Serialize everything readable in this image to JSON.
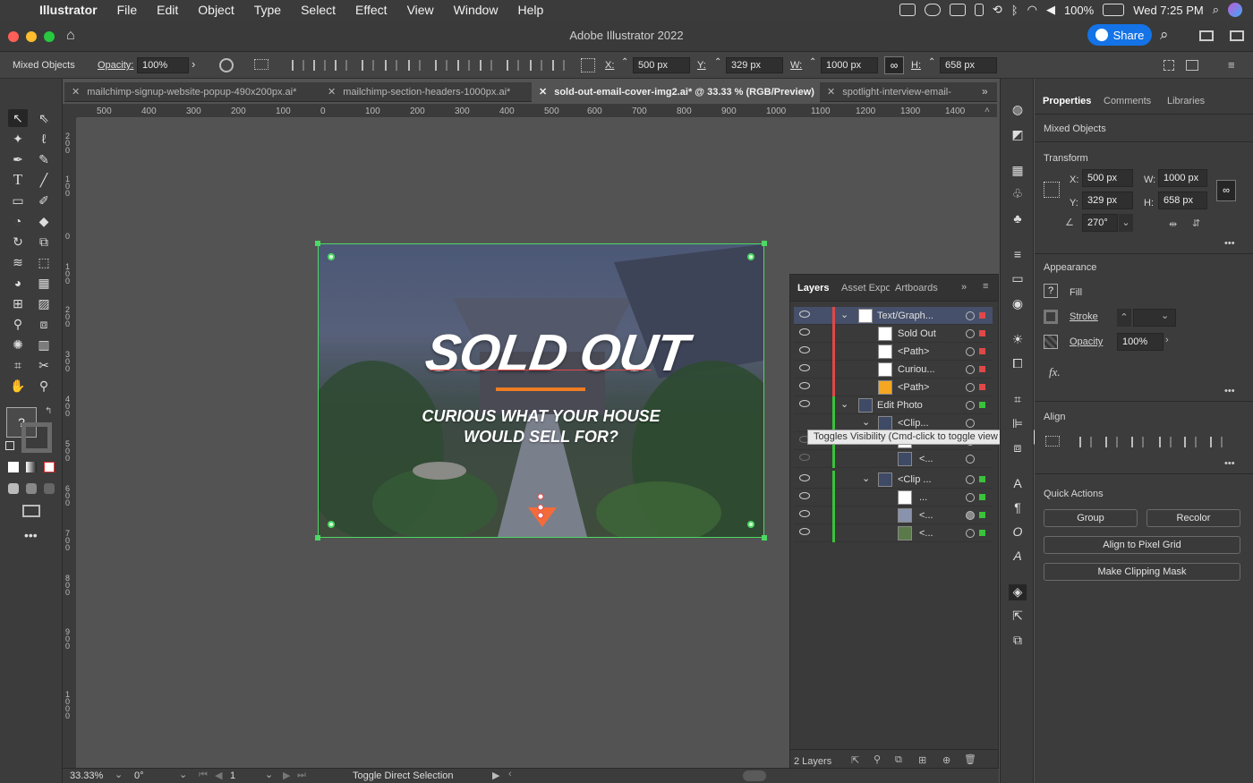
{
  "menubar": {
    "app": "Illustrator",
    "items": [
      "File",
      "Edit",
      "Object",
      "Type",
      "Select",
      "Effect",
      "View",
      "Window",
      "Help"
    ],
    "battery": "100%",
    "clock": "Wed 7:25 PM"
  },
  "appbar": {
    "title": "Adobe Illustrator 2022",
    "share_label": "Share"
  },
  "control": {
    "selection_label": "Mixed Objects",
    "opacity_label": "Opacity:",
    "opacity_value": "100%",
    "x_label": "X:",
    "x_value": "500 px",
    "y_label": "Y:",
    "y_value": "329 px",
    "w_label": "W:",
    "w_value": "1000 px",
    "h_label": "H:",
    "h_value": "658 px"
  },
  "tabs": [
    {
      "label": "mailchimp-signup-website-popup-490x200px.ai*"
    },
    {
      "label": "mailchimp-section-headers-1000px.ai*"
    },
    {
      "label": "sold-out-email-cover-img2.ai* @ 33.33 % (RGB/Preview)"
    },
    {
      "label": "spotlight-interview-email-"
    }
  ],
  "ruler": {
    "h": [
      "500",
      "400",
      "300",
      "200",
      "100",
      "0",
      "100",
      "200",
      "300",
      "400",
      "500",
      "600",
      "700",
      "800",
      "900",
      "1000",
      "1100",
      "1200",
      "1300",
      "1400"
    ],
    "v": [
      "200",
      "100",
      "0",
      "100",
      "200",
      "300",
      "400",
      "500",
      "600",
      "700",
      "800",
      "900",
      "1000"
    ]
  },
  "artboard": {
    "headline": "SOLD OUT",
    "subline1": "CURIOUS WHAT YOUR HOUSE",
    "subline2": "WOULD SELL FOR?"
  },
  "properties": {
    "tabs": [
      "Properties",
      "Comments",
      "Libraries"
    ],
    "selection": "Mixed Objects",
    "transform_header": "Transform",
    "x_label": "X:",
    "x": "500 px",
    "y_label": "Y:",
    "y": "329 px",
    "w_label": "W:",
    "w": "1000 px",
    "h_label": "H:",
    "h": "658 px",
    "angle": "270°",
    "appearance_header": "Appearance",
    "fill_label": "Fill",
    "stroke_label": "Stroke",
    "opacity_label": "Opacity",
    "opacity": "100%",
    "fx_label": "fx.",
    "align_header": "Align",
    "quick_actions_header": "Quick Actions",
    "btn_group": "Group",
    "btn_recolor": "Recolor",
    "btn_align_pixel": "Align to Pixel Grid",
    "btn_clipping": "Make Clipping Mask"
  },
  "layers": {
    "tabs": [
      "Layers",
      "Asset Expo",
      "Artboards"
    ],
    "rows": [
      {
        "name": "Text/Graph..."
      },
      {
        "name": "Sold Out"
      },
      {
        "name": "<Path>"
      },
      {
        "name": "Curiou..."
      },
      {
        "name": "<Path>"
      },
      {
        "name": "Edit Photo"
      },
      {
        "name": "<Clip..."
      },
      {
        "name": "..."
      },
      {
        "name": "<..."
      },
      {
        "name": "<Clip ..."
      },
      {
        "name": "..."
      },
      {
        "name": "<..."
      },
      {
        "name": "<..."
      }
    ],
    "count": "2 Layers",
    "tooltip": "Toggles Visibility (Cmd-click to toggle view mode)"
  },
  "status": {
    "zoom": "33.33%",
    "rotation": "0°",
    "artboard": "1",
    "message": "Toggle Direct Selection"
  },
  "colors": {
    "accent": "#1473e6",
    "selection": "#4cd964",
    "layer_red": "#e04848",
    "layer_green": "#3ac23a"
  }
}
